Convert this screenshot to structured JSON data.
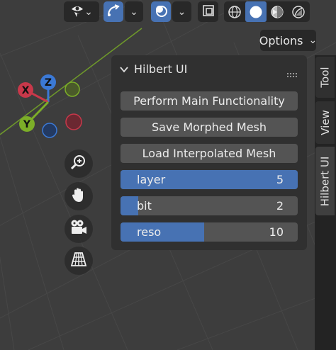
{
  "header": {
    "visibility_icon": "eye-arrow-icon",
    "gizmo_icon": "gizmo-curve-icon",
    "overlay_icon": "overlay-circles-icon",
    "xray_icon": "xray-toggle-icon",
    "shading_modes": [
      "wireframe-shading-icon",
      "solid-shading-icon",
      "material-preview-icon",
      "rendered-shading-icon"
    ],
    "active_shading": "solid-shading-icon"
  },
  "options": {
    "label": "Options"
  },
  "gizmo": {
    "x_label": "X",
    "y_label": "Y",
    "z_label": "Z"
  },
  "nav_buttons": [
    "zoom-icon",
    "hand-pan-icon",
    "camera-icon",
    "perspective-grid-icon"
  ],
  "sidebar_tabs": [
    {
      "label": "Tool",
      "active": false
    },
    {
      "label": "View",
      "active": false
    },
    {
      "label": "Hilbert UI",
      "active": true
    }
  ],
  "panel": {
    "title": "Hilbert UI",
    "buttons": [
      {
        "label": "Perform Main Functionality"
      },
      {
        "label": "Save Morphed Mesh"
      },
      {
        "label": "Load Interpolated Mesh"
      }
    ],
    "sliders": [
      {
        "label": "layer",
        "value": "5",
        "fill": 1.0
      },
      {
        "label": "bit",
        "value": "2",
        "fill": 0.1
      },
      {
        "label": "reso",
        "value": "10",
        "fill": 0.47
      }
    ]
  },
  "colors": {
    "accent": "#4772b3",
    "x_axis": "#c8384a",
    "y_axis": "#7cae28",
    "z_axis": "#3b79d6"
  }
}
